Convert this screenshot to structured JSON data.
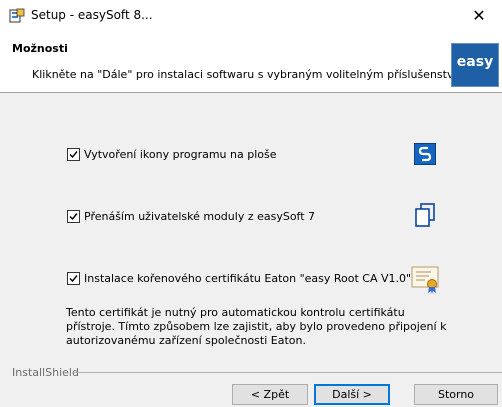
{
  "window": {
    "title": "Setup - easySoft 8...",
    "close_label": "✕"
  },
  "header": {
    "title": "Možnosti",
    "subtitle": "Klikněte na \"Dále\" pro instalaci softwaru s vybraným volitelným příslušenstvím",
    "logo_text": "easy"
  },
  "options": [
    {
      "label": "Vytvoření ikony programu na ploše",
      "checked": true,
      "icon": "easysoft-shortcut-icon"
    },
    {
      "label": "Přenáším uživatelské moduly z easySoft 7",
      "checked": true,
      "icon": "copy-modules-icon"
    },
    {
      "label": "Instalace kořenového certifikátu Eaton \"easy Root CA V1.0\"",
      "checked": true,
      "icon": "certificate-icon"
    }
  ],
  "description": "Tento certifikát je nutný pro automatickou kontrolu certifikátu přístroje. Tímto způsobem lze zajistit, aby bylo provedeno připojení k autorizovanému zařízení společnosti Eaton.",
  "footer": {
    "brand": "InstallShield",
    "back_label": "< Zpět",
    "next_label": "Další >",
    "cancel_label": "Storno"
  },
  "colors": {
    "accent": "#0078d7",
    "logo_bg": "#1f5fa6",
    "icon_blue": "#1565c0"
  }
}
